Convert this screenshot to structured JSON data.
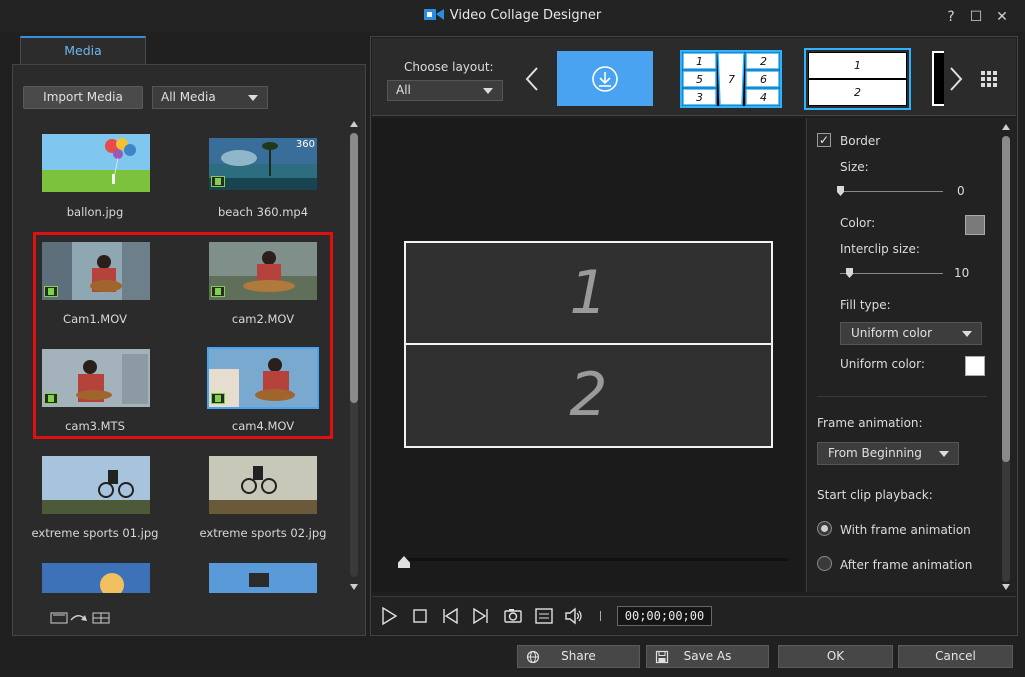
{
  "window": {
    "title": "Video Collage Designer",
    "help_glyph": "?",
    "maximize_glyph": "☐",
    "close_glyph": "✕"
  },
  "media_panel": {
    "tab_label": "Media",
    "import_button": "Import Media",
    "filter": {
      "selected": "All Media"
    },
    "items": [
      {
        "name": "ballon.jpg",
        "kind": "image",
        "selected": false,
        "badge": ""
      },
      {
        "name": "beach 360.mp4",
        "kind": "video",
        "selected": false,
        "badge": "360"
      },
      {
        "name": "Cam1.MOV",
        "kind": "video",
        "selected": false,
        "badge": ""
      },
      {
        "name": "cam2.MOV",
        "kind": "video",
        "selected": false,
        "badge": ""
      },
      {
        "name": "cam3.MTS",
        "kind": "video",
        "selected": false,
        "badge": ""
      },
      {
        "name": "cam4.MOV",
        "kind": "video",
        "selected": true,
        "badge": ""
      },
      {
        "name": "extreme sports 01.jpg",
        "kind": "image",
        "selected": false,
        "badge": ""
      },
      {
        "name": "extreme sports 02.jpg",
        "kind": "image",
        "selected": false,
        "badge": ""
      }
    ],
    "highlight_color": "#e01010"
  },
  "layout_bar": {
    "choose_label": "Choose layout:",
    "filter_selected": "All",
    "layout7": [
      "1",
      "2",
      "5",
      "7",
      "6",
      "3",
      "4"
    ],
    "layout2": [
      "1",
      "2"
    ]
  },
  "preview": {
    "frames": [
      "1",
      "2"
    ]
  },
  "properties": {
    "border_label": "Border",
    "border_checked": true,
    "check_glyph": "✓",
    "size_label": "Size:",
    "size_value": "0",
    "color_label": "Color:",
    "border_color": "#7a7a7a",
    "interclip_label": "Interclip size:",
    "interclip_value": "10",
    "fill_type_label": "Fill type:",
    "fill_type_value": "Uniform color",
    "uniform_color_label": "Uniform color:",
    "uniform_color": "#ffffff",
    "frame_animation_label": "Frame animation:",
    "frame_animation_value": "From Beginning",
    "start_playback_label": "Start clip playback:",
    "options": [
      {
        "label": "With frame animation",
        "selected": true
      },
      {
        "label": "After frame animation",
        "selected": false
      }
    ]
  },
  "playback": {
    "timecode": "00;00;00;00"
  },
  "footer": {
    "share": "Share",
    "save_as": "Save As",
    "ok": "OK",
    "cancel": "Cancel"
  },
  "colors": {
    "accent": "#3b8fd6",
    "layout_highlight": "#2fb3ff",
    "selected_tile": "#4aa3f0"
  }
}
